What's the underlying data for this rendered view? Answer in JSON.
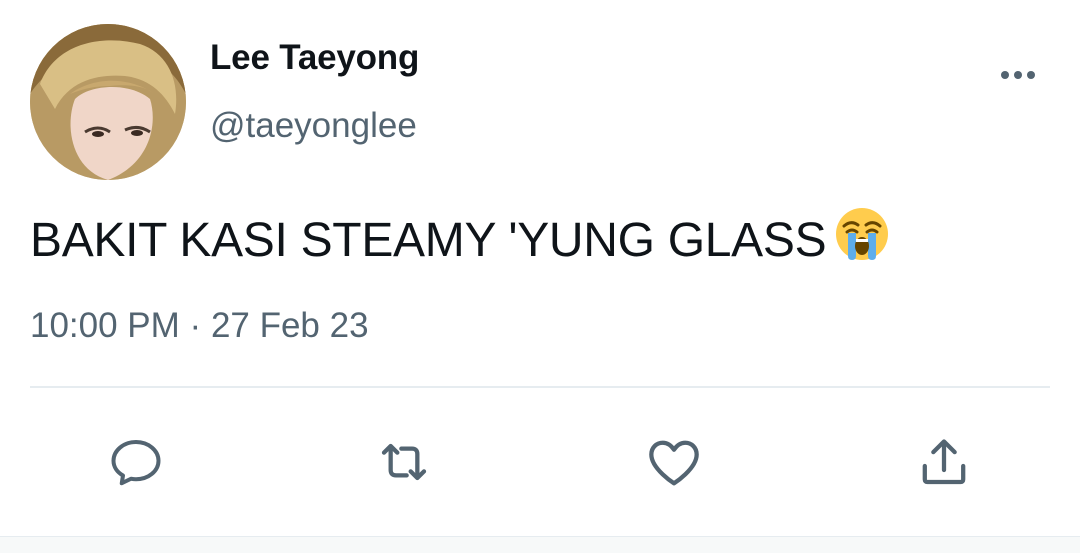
{
  "author": {
    "display_name": "Lee Taeyong",
    "handle": "@taeyonglee"
  },
  "tweet": {
    "text": "BAKIT KASI STEAMY 'YUNG GLASS",
    "emoji": "loudly-crying-face",
    "time": "10:00 PM",
    "separator": "·",
    "date": "27 Feb 23"
  },
  "actions": [
    "reply-icon",
    "retweet-icon",
    "like-icon",
    "share-icon"
  ],
  "colors": {
    "text": "#0f1419",
    "secondary": "#536471",
    "divider": "#e6ecf0"
  }
}
